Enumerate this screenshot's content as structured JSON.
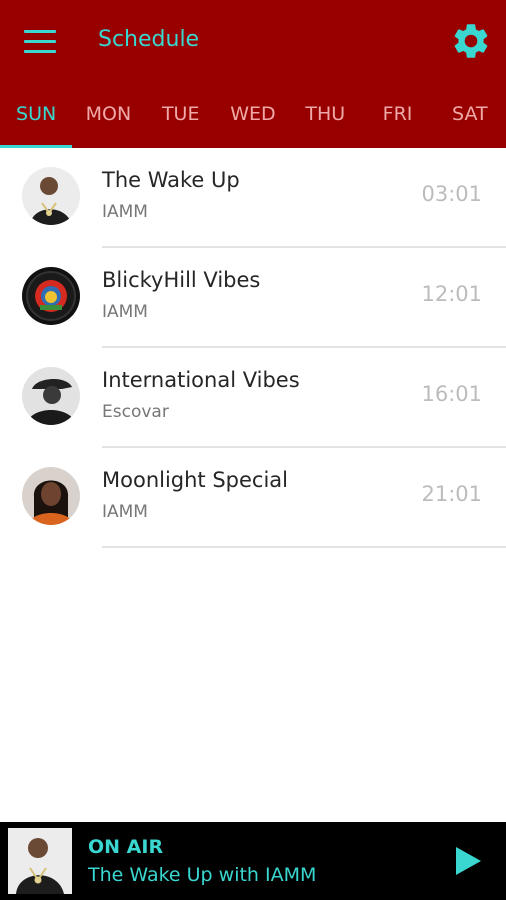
{
  "appbar": {
    "title": "Schedule",
    "menu_icon": "hamburger-menu-icon",
    "settings_icon": "gear-icon",
    "colors": {
      "background": "#980000",
      "accent": "#3ad6d0",
      "inactive_tab": "#f0a9a9"
    }
  },
  "tabs": [
    {
      "label": "SUN",
      "active": true
    },
    {
      "label": "MON",
      "active": false
    },
    {
      "label": "TUE",
      "active": false
    },
    {
      "label": "WED",
      "active": false
    },
    {
      "label": "THU",
      "active": false
    },
    {
      "label": "FRI",
      "active": false
    },
    {
      "label": "SAT",
      "active": false
    }
  ],
  "schedule": [
    {
      "title": "The Wake Up",
      "host": "IAMM",
      "time": "03:01"
    },
    {
      "title": "BlickyHill Vibes",
      "host": "IAMM",
      "time": "12:01"
    },
    {
      "title": "International Vibes",
      "host": "Escovar",
      "time": "16:01"
    },
    {
      "title": "Moonlight Special",
      "host": "IAMM",
      "time": "21:01"
    }
  ],
  "player": {
    "status": "ON AIR",
    "now_playing": "The Wake Up with IAMM",
    "play_icon": "play-icon"
  }
}
